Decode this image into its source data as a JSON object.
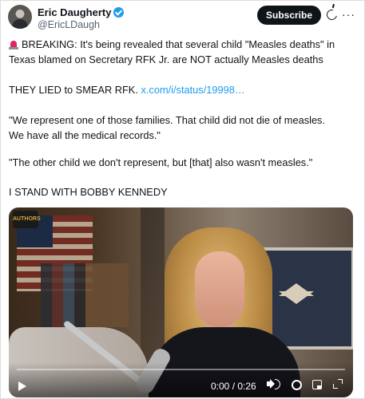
{
  "author": {
    "name": "Eric Daugherty",
    "handle": "@EricLDaugh",
    "verified": true
  },
  "header": {
    "subscribe_label": "Subscribe",
    "icons": [
      "grok-icon",
      "more-icon"
    ]
  },
  "tweet": {
    "line1_emoji": "siren-icon",
    "line1": "BREAKING: It's being revealed that several child \"Measles deaths\" in",
    "line2": "Texas blamed on Secretary RFK Jr. are NOT actually Measles deaths",
    "line3_text": "THEY LIED to SMEAR RFK.",
    "line3_link": "x.com/i/status/19998…",
    "line4": "\"We represent one of those families. That child did not die of measles.",
    "line5": "We have all the medical records.\"",
    "line6": "\"The other child we don't represent, but [that] also wasn't measles.\"",
    "line7": "I STAND WITH BOBBY KENNEDY"
  },
  "video": {
    "logo_text": "AUTHORS",
    "time": "0:00 / 0:26",
    "progress": 0,
    "controls": [
      "play-icon",
      "volume-icon",
      "settings-icon",
      "pip-icon",
      "fullscreen-icon"
    ]
  },
  "colors": {
    "link": "#1d9bf0",
    "verified": "#1d9bf0",
    "subscribe_bg": "#0f1419",
    "siren": "#e0245e"
  }
}
